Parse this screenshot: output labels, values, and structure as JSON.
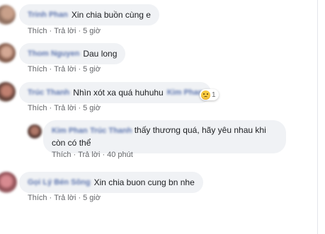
{
  "comments": [
    {
      "name": "Trinh Phan",
      "text": "Xin chia buồn cùng e",
      "actions": {
        "like": "Thích",
        "reply": "Trả lời",
        "time": "5 giờ"
      }
    },
    {
      "name": "Thom Nguyen",
      "text": "Dau long",
      "actions": {
        "like": "Thích",
        "reply": "Trả lời",
        "time": "5 giờ"
      }
    },
    {
      "name": "Trúc Thanh",
      "text": "Nhìn xót xa quá huhuhu",
      "tag": "Kim Phan",
      "reaction_count": "1",
      "actions": {
        "like": "Thích",
        "reply": "Trả lời",
        "time": "5 giờ"
      }
    },
    {
      "name": "Gọi Lý Bén Sông",
      "text": "Xin chia buon cung bn nhe",
      "actions": {
        "like": "Thích",
        "reply": "Trả lời",
        "time": "5 giờ"
      }
    }
  ],
  "reply": {
    "name": "Kim Phan",
    "tag": "Trúc Thanh",
    "text": "thấy thương quá, hãy yêu nhau khi còn có thể",
    "actions": {
      "like": "Thích",
      "reply": "Trả lời",
      "time": "40 phút"
    }
  },
  "colors": {
    "bubble_bg": "#f0f2f5",
    "name_link": "#4b66a6",
    "meta_text": "#65676b",
    "reaction_sad": "#f7c840"
  },
  "icons": {
    "reaction": "sad-face-icon"
  }
}
